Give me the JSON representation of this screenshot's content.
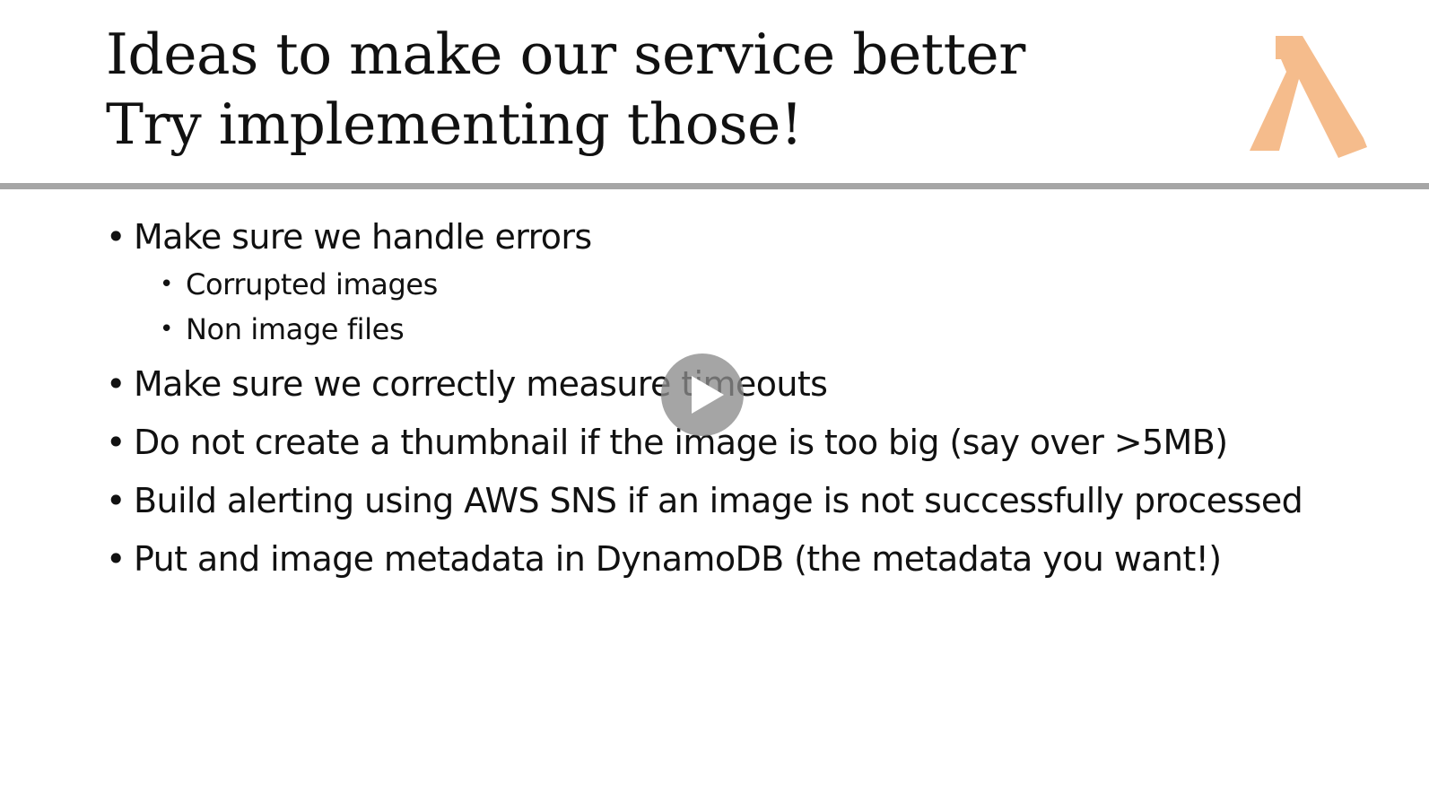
{
  "slide": {
    "title_lines": [
      "Ideas to make our service better",
      "Try implementing those!"
    ],
    "logo": {
      "icon": "lambda-icon",
      "color": "#f5bc8c"
    },
    "divider_color": "#a6a6a6",
    "bullets": [
      {
        "text": "Make sure we handle errors",
        "subs": [
          "Corrupted images",
          "Non image files"
        ]
      },
      {
        "text": "Make sure we correctly measure timeouts"
      },
      {
        "text": "Do not create a thumbnail if the image is too big (say over >5MB)"
      },
      {
        "text": "Build alerting using AWS SNS if an image is not successfully processed"
      },
      {
        "text": "Put and image metadata in DynamoDB (the metadata you want!)"
      }
    ]
  },
  "player": {
    "play_icon": "play-icon"
  }
}
